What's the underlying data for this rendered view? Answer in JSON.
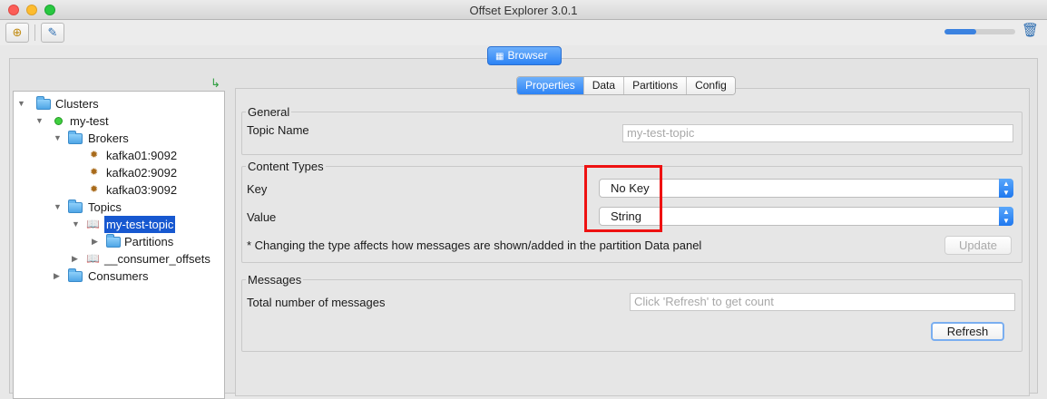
{
  "window": {
    "title": "Offset Explorer  3.0.1"
  },
  "toolbar": {
    "progress": 0.45
  },
  "browser_tab": {
    "label": "Browser"
  },
  "tree": {
    "clusters_label": "Clusters",
    "cluster_name": "my-test",
    "brokers_label": "Brokers",
    "brokers": [
      "kafka01:9092",
      "kafka02:9092",
      "kafka03:9092"
    ],
    "topics_label": "Topics",
    "selected_topic": "my-test-topic",
    "partitions_label": "Partitions",
    "other_topic": "__consumer_offsets",
    "consumers_label": "Consumers"
  },
  "tabs": [
    "Properties",
    "Data",
    "Partitions",
    "Config"
  ],
  "general": {
    "title": "General",
    "topic_name_label": "Topic Name",
    "topic_name_value": "my-test-topic"
  },
  "content_types": {
    "title": "Content Types",
    "key_label": "Key",
    "key_value": "No Key",
    "value_label": "Value",
    "value_value": "String",
    "note": "* Changing the type affects how messages are shown/added in the partition Data panel",
    "update_label": "Update"
  },
  "messages": {
    "title": "Messages",
    "total_label": "Total number of messages",
    "count_placeholder": "Click 'Refresh' to get count",
    "refresh_label": "Refresh"
  }
}
